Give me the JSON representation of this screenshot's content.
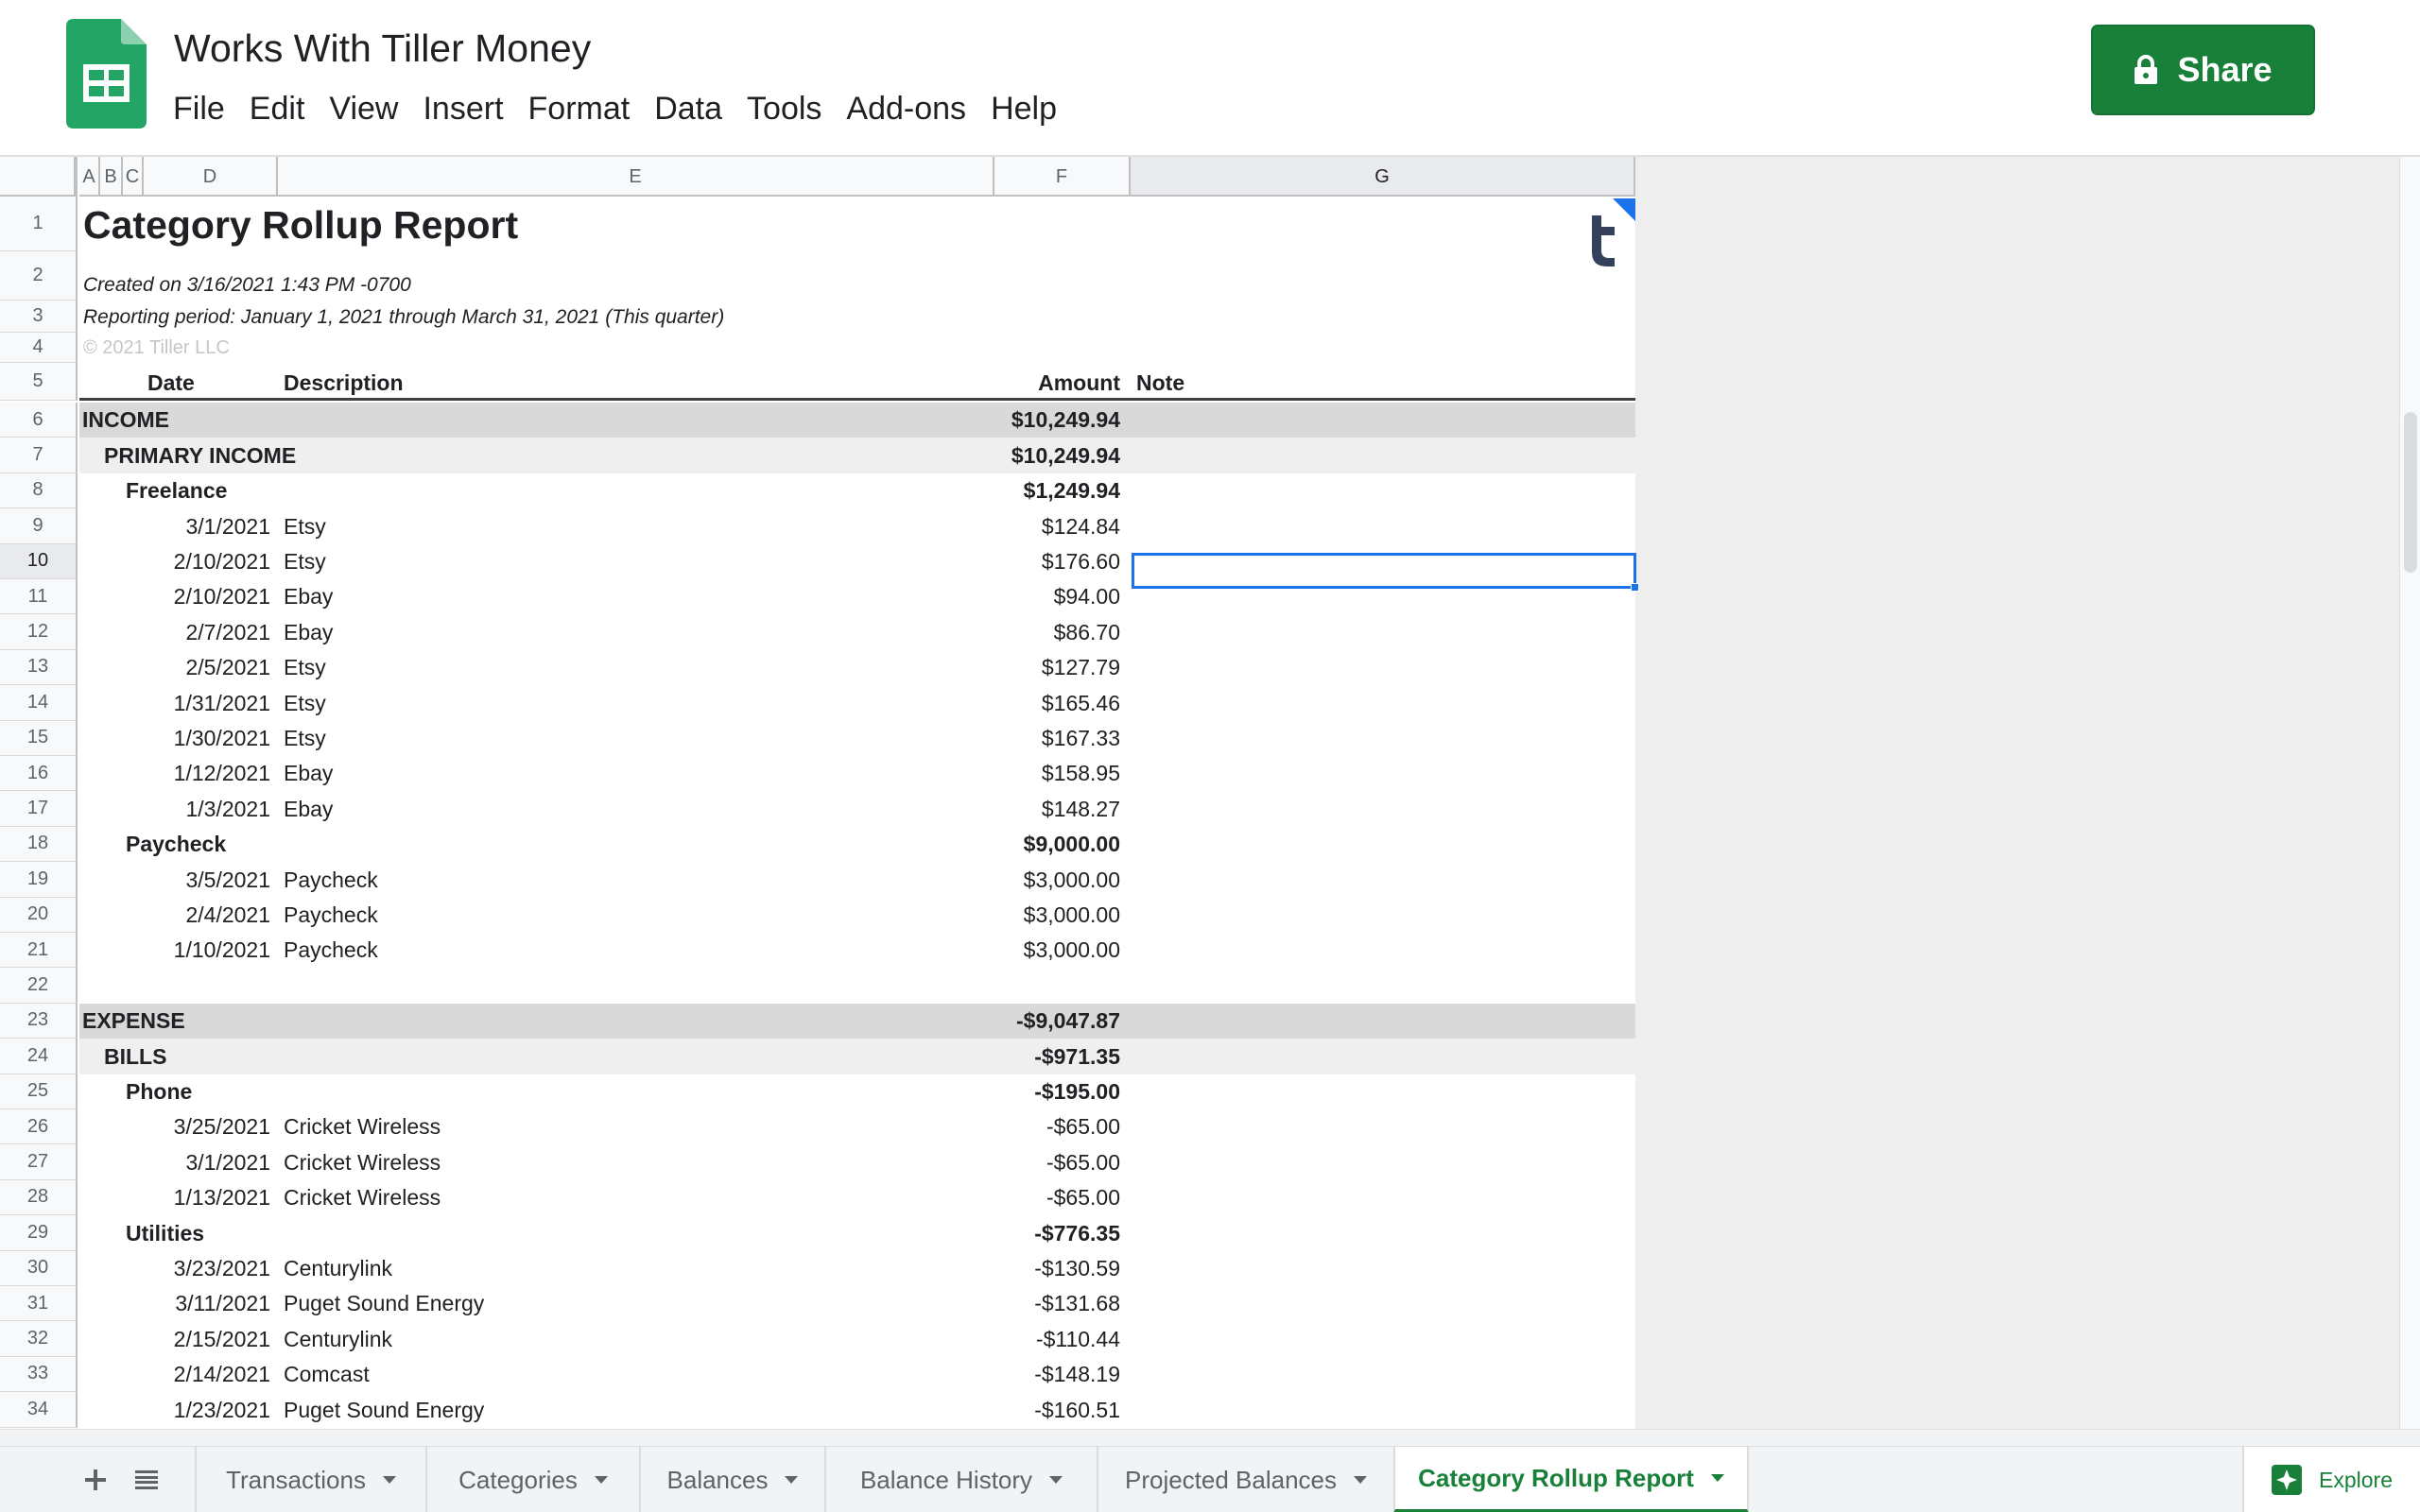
{
  "app": {
    "doc_title": "Works With Tiller Money",
    "menu": [
      "File",
      "Edit",
      "View",
      "Insert",
      "Format",
      "Data",
      "Tools",
      "Add-ons",
      "Help"
    ],
    "share_label": "Share",
    "accent_color": "#188038"
  },
  "grid": {
    "columns": [
      "A",
      "B",
      "C",
      "D",
      "E",
      "F",
      "G"
    ],
    "selected_column": "G",
    "selected_row": "10"
  },
  "report": {
    "title": "Category Rollup Report",
    "created": "Created on 3/16/2021 1:43 PM -0700",
    "period": "Reporting period: January 1, 2021 through March 31, 2021 (This quarter)",
    "copyright": "© 2021 Tiller LLC",
    "headers": {
      "date": "Date",
      "description": "Description",
      "amount": "Amount",
      "note": "Note"
    },
    "rows": [
      {
        "n": "6",
        "kind": "group",
        "label": "INCOME",
        "amount": "$10,249.94"
      },
      {
        "n": "7",
        "kind": "subgroup",
        "label": "PRIMARY INCOME",
        "amount": "$10,249.94"
      },
      {
        "n": "8",
        "kind": "category",
        "label": "Freelance",
        "amount": "$1,249.94"
      },
      {
        "n": "9",
        "kind": "txn",
        "date": "3/1/2021",
        "desc": "Etsy",
        "amount": "$124.84"
      },
      {
        "n": "10",
        "kind": "txn",
        "date": "2/10/2021",
        "desc": "Etsy",
        "amount": "$176.60"
      },
      {
        "n": "11",
        "kind": "txn",
        "date": "2/10/2021",
        "desc": "Ebay",
        "amount": "$94.00"
      },
      {
        "n": "12",
        "kind": "txn",
        "date": "2/7/2021",
        "desc": "Ebay",
        "amount": "$86.70"
      },
      {
        "n": "13",
        "kind": "txn",
        "date": "2/5/2021",
        "desc": "Etsy",
        "amount": "$127.79"
      },
      {
        "n": "14",
        "kind": "txn",
        "date": "1/31/2021",
        "desc": "Etsy",
        "amount": "$165.46"
      },
      {
        "n": "15",
        "kind": "txn",
        "date": "1/30/2021",
        "desc": "Etsy",
        "amount": "$167.33"
      },
      {
        "n": "16",
        "kind": "txn",
        "date": "1/12/2021",
        "desc": "Ebay",
        "amount": "$158.95"
      },
      {
        "n": "17",
        "kind": "txn",
        "date": "1/3/2021",
        "desc": "Ebay",
        "amount": "$148.27"
      },
      {
        "n": "18",
        "kind": "category",
        "label": "Paycheck",
        "amount": "$9,000.00"
      },
      {
        "n": "19",
        "kind": "txn",
        "date": "3/5/2021",
        "desc": "Paycheck",
        "amount": "$3,000.00"
      },
      {
        "n": "20",
        "kind": "txn",
        "date": "2/4/2021",
        "desc": "Paycheck",
        "amount": "$3,000.00"
      },
      {
        "n": "21",
        "kind": "txn",
        "date": "1/10/2021",
        "desc": "Paycheck",
        "amount": "$3,000.00"
      },
      {
        "n": "22",
        "kind": "blank"
      },
      {
        "n": "23",
        "kind": "group",
        "label": "EXPENSE",
        "amount": "-$9,047.87"
      },
      {
        "n": "24",
        "kind": "subgroup",
        "label": "BILLS",
        "amount": "-$971.35"
      },
      {
        "n": "25",
        "kind": "category",
        "label": "Phone",
        "amount": "-$195.00"
      },
      {
        "n": "26",
        "kind": "txn",
        "date": "3/25/2021",
        "desc": "Cricket Wireless",
        "amount": "-$65.00"
      },
      {
        "n": "27",
        "kind": "txn",
        "date": "3/1/2021",
        "desc": "Cricket Wireless",
        "amount": "-$65.00"
      },
      {
        "n": "28",
        "kind": "txn",
        "date": "1/13/2021",
        "desc": "Cricket Wireless",
        "amount": "-$65.00"
      },
      {
        "n": "29",
        "kind": "category",
        "label": "Utilities",
        "amount": "-$776.35"
      },
      {
        "n": "30",
        "kind": "txn",
        "date": "3/23/2021",
        "desc": "Centurylink",
        "amount": "-$130.59"
      },
      {
        "n": "31",
        "kind": "txn",
        "date": "3/11/2021",
        "desc": "Puget Sound Energy",
        "amount": "-$131.68"
      },
      {
        "n": "32",
        "kind": "txn",
        "date": "2/15/2021",
        "desc": "Centurylink",
        "amount": "-$110.44"
      },
      {
        "n": "33",
        "kind": "txn",
        "date": "2/14/2021",
        "desc": "Comcast",
        "amount": "-$148.19"
      },
      {
        "n": "34",
        "kind": "txn",
        "date": "1/23/2021",
        "desc": "Puget Sound Energy",
        "amount": "-$160.51"
      }
    ]
  },
  "tabs": {
    "items": [
      "Transactions",
      "Categories",
      "Balances",
      "Balance History",
      "Projected Balances",
      "Category Rollup Report"
    ],
    "active": "Category Rollup Report",
    "explore_label": "Explore"
  }
}
